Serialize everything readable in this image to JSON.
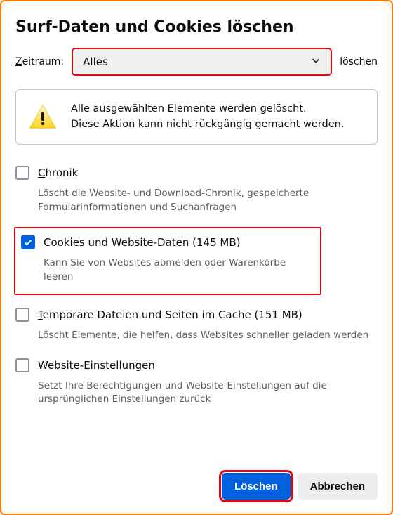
{
  "title": "Surf-Daten und Cookies löschen",
  "timerange": {
    "label": "Zeitraum:",
    "value": "Alles",
    "after": "löschen"
  },
  "warning": {
    "line1": "Alle ausgewählten Elemente werden gelöscht.",
    "line2": "Diese Aktion kann nicht rückgängig gemacht werden."
  },
  "options": [
    {
      "label": "Chronik",
      "desc": "Löscht die Website- und Download-Chronik, gespeicherte Formularinformationen und Suchanfragen",
      "checked": false
    },
    {
      "label": "Cookies und Website-Daten (145 MB)",
      "desc": "Kann Sie von Websites abmelden oder Warenkörbe leeren",
      "checked": true
    },
    {
      "label": "Temporäre Dateien und Seiten im Cache (151 MB)",
      "desc": "Löscht Elemente, die helfen, dass Websites schneller geladen werden",
      "checked": false
    },
    {
      "label": "Website-Einstellungen",
      "desc": "Setzt Ihre Berechtigungen und Website-Einstellungen auf die ursprünglichen Einstellungen zurück",
      "checked": false
    }
  ],
  "buttons": {
    "primary": "Löschen",
    "secondary": "Abbrechen"
  }
}
